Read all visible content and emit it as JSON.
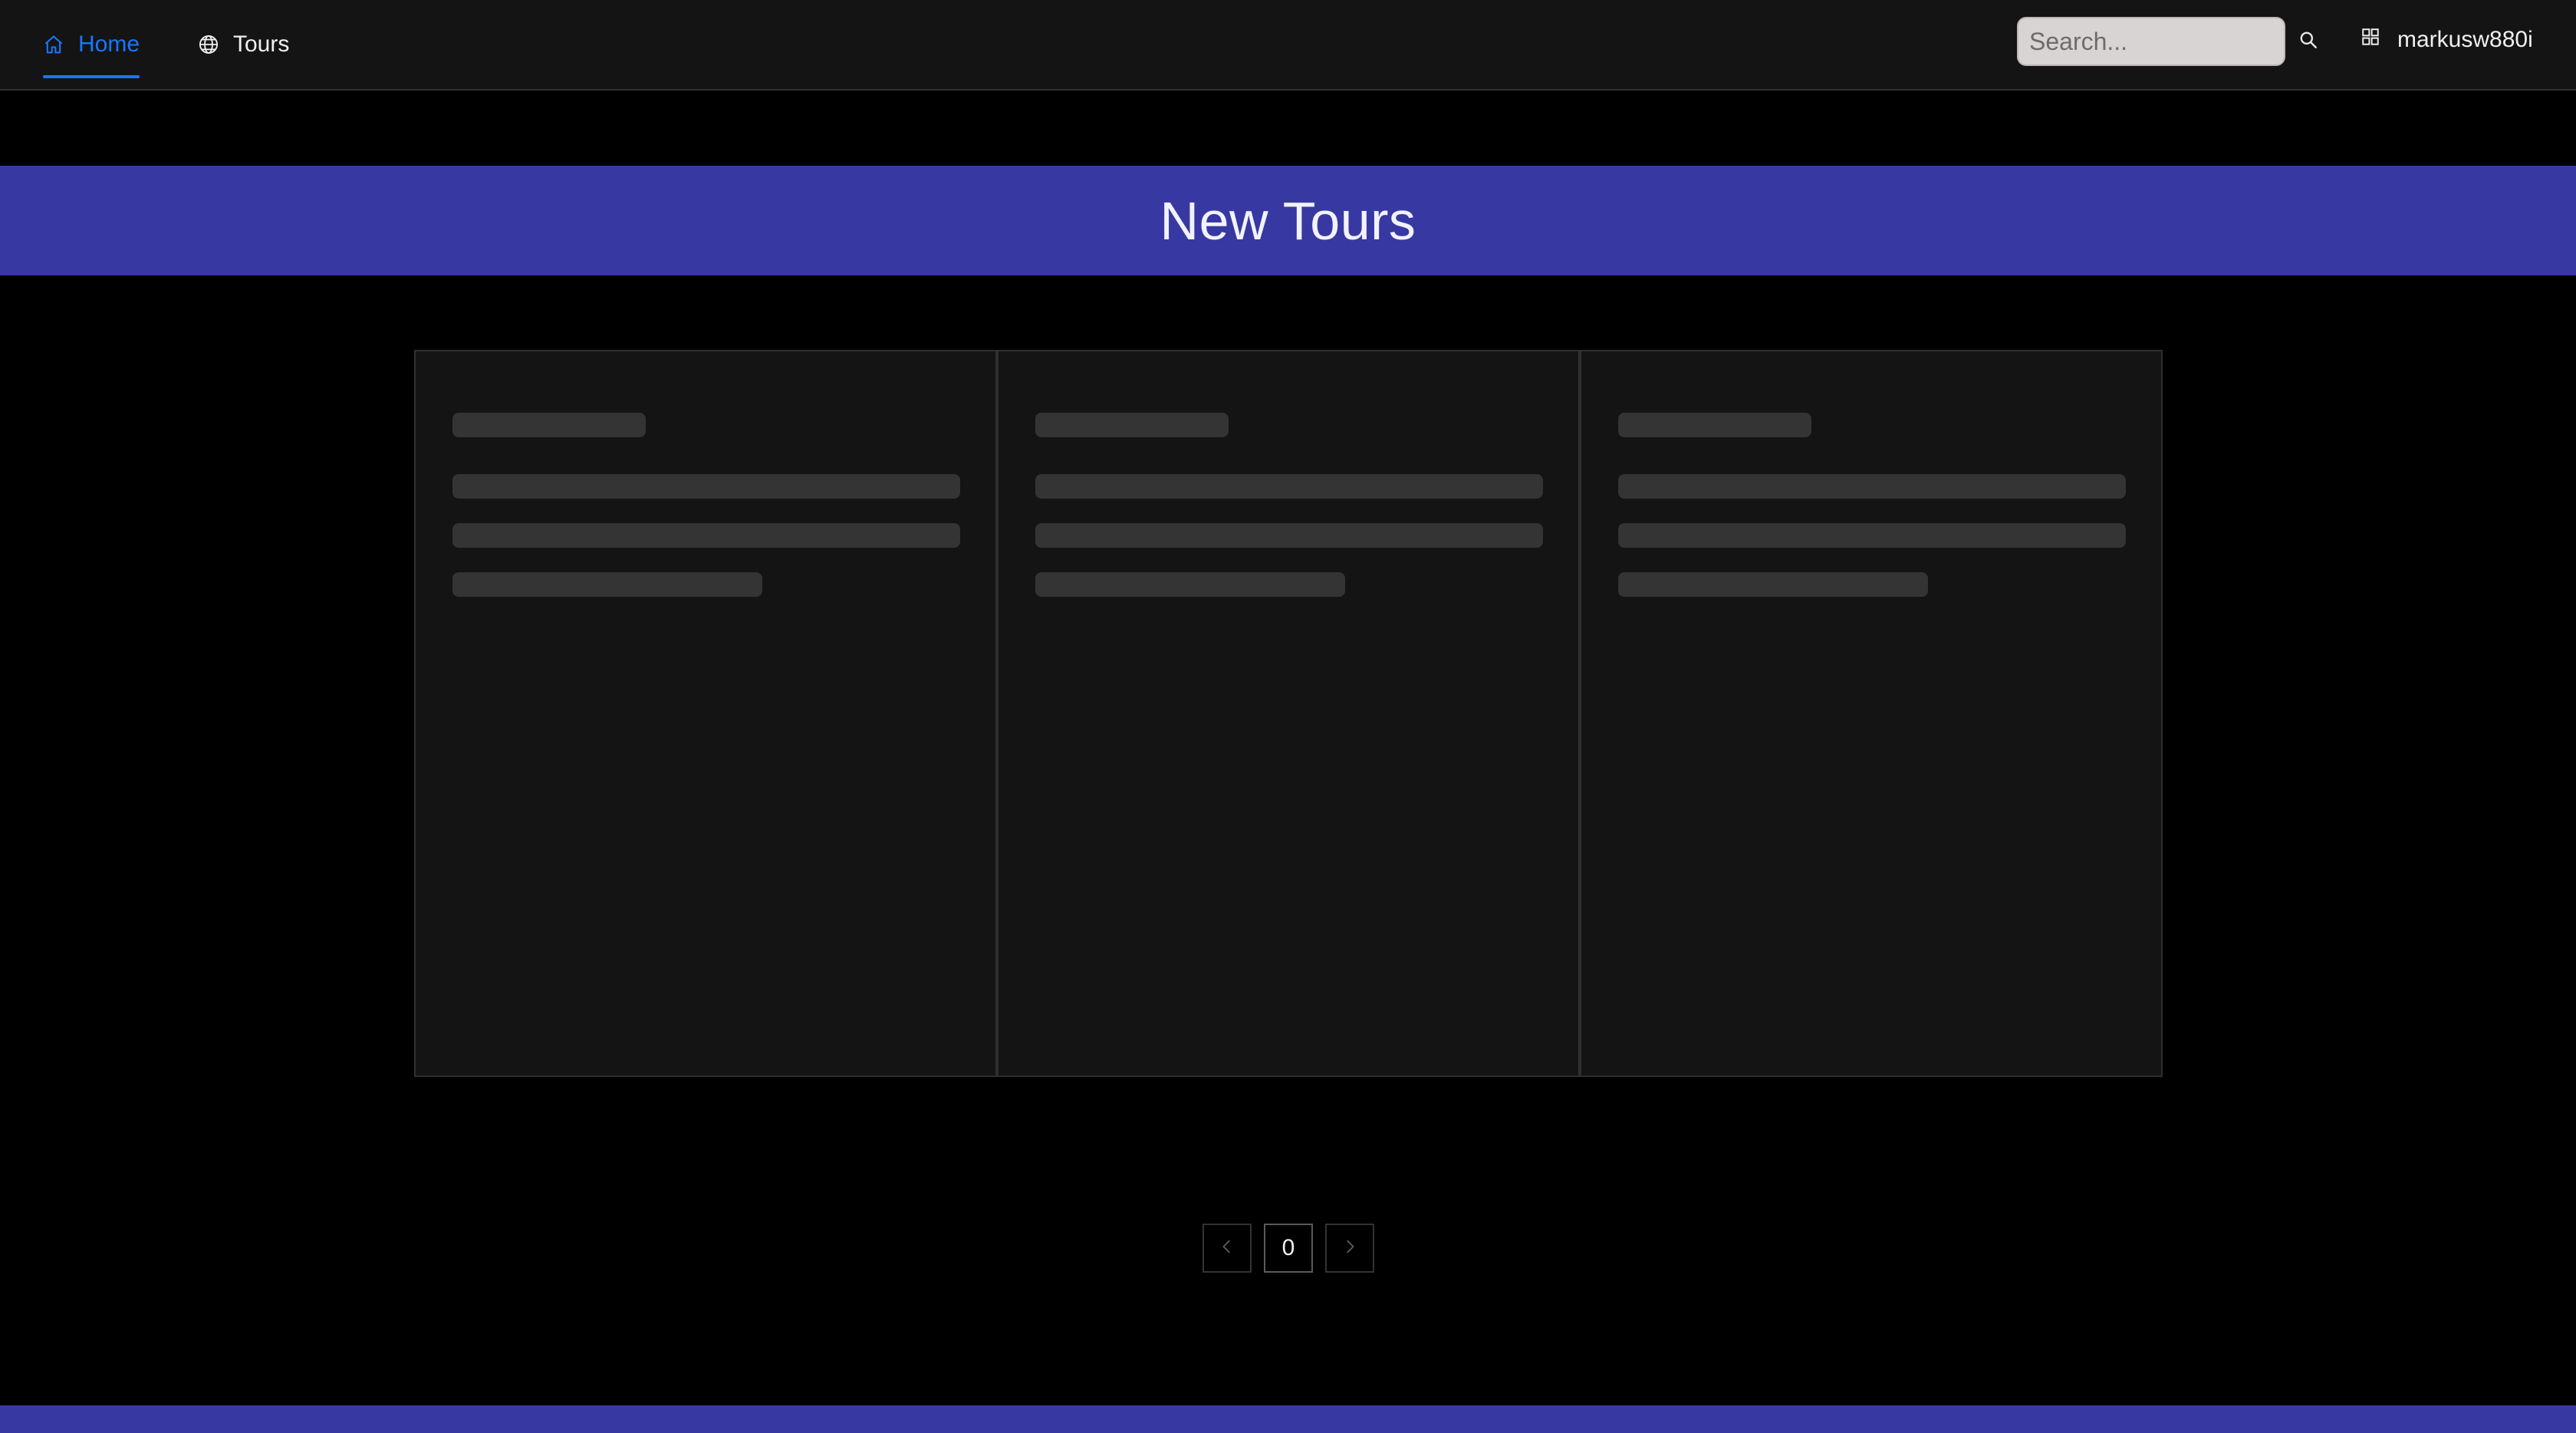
{
  "nav": {
    "home_label": "Home",
    "tours_label": "Tours",
    "active": "Home"
  },
  "search": {
    "placeholder": "Search...",
    "value": ""
  },
  "user": {
    "username": "markusw880i"
  },
  "banner": {
    "title": "New Tours"
  },
  "pagination": {
    "current_page": "0",
    "prev_icon": "chevron-left-icon",
    "next_icon": "chevron-right-icon"
  },
  "colors": {
    "accent": "#1677ff",
    "banner": "#3838a2",
    "nav_background": "#141414",
    "page_background": "#000000",
    "skeleton": "#343434",
    "card_background": "#141414"
  }
}
